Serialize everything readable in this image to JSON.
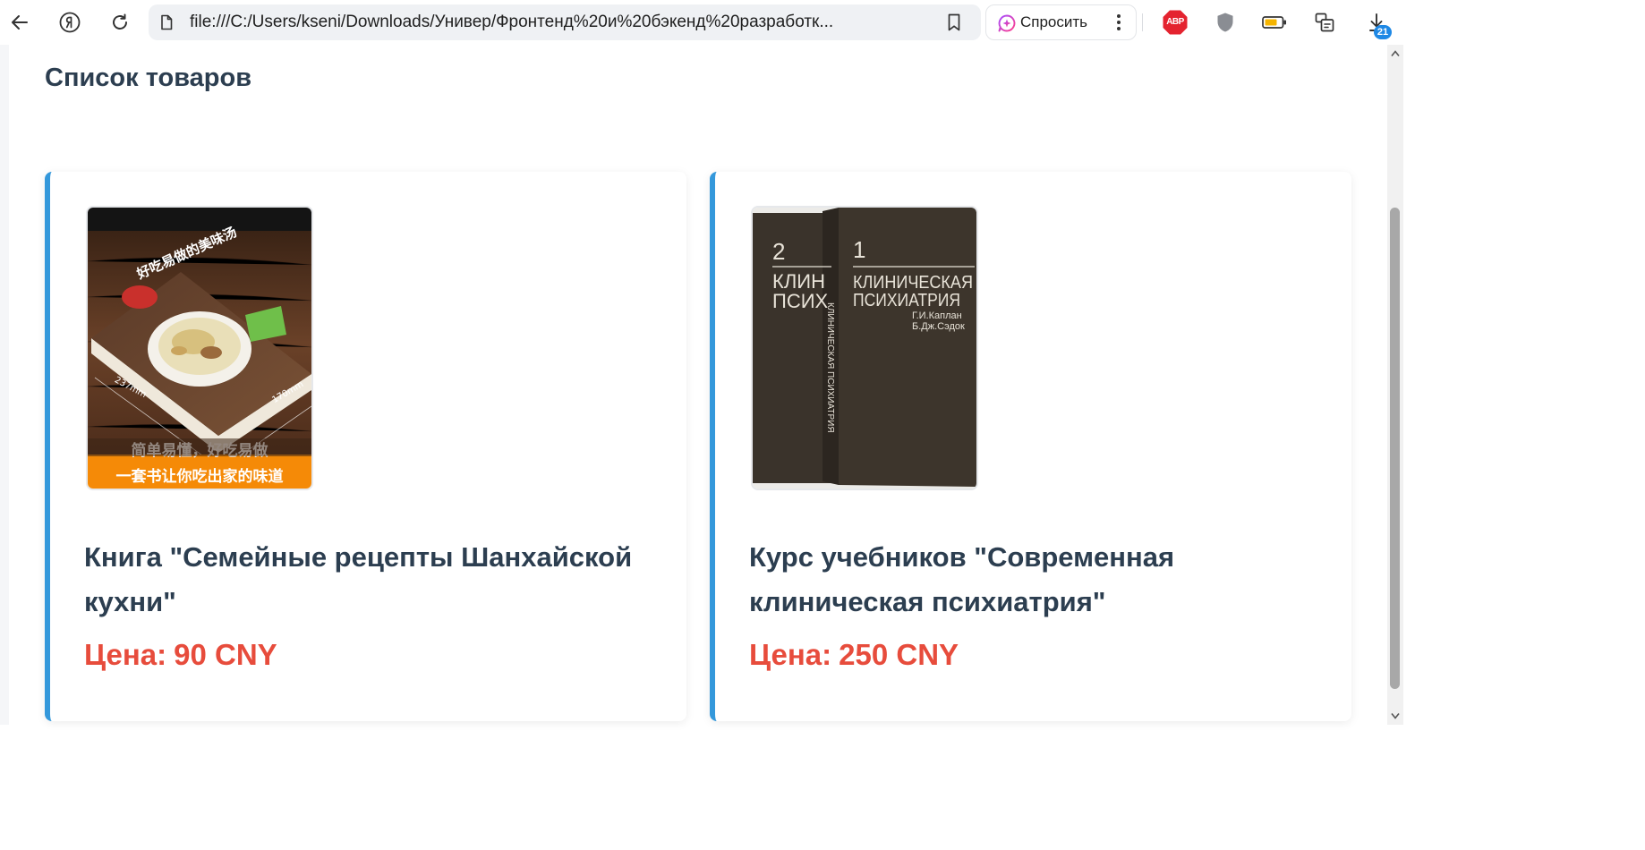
{
  "browser": {
    "url": "file:///C:/Users/kseni/Downloads/Универ/Фронтенд%20и%20бэкенд%20разработк...",
    "ask_label": "Спросить",
    "abp_label": "ABP",
    "downloads_badge": "21",
    "icons": [
      "back-icon",
      "yandex-icon",
      "reload-icon",
      "file-icon",
      "bookmark-icon",
      "ask-icon",
      "menu-dots-icon",
      "adblock-icon",
      "shield-icon",
      "battery-icon",
      "screenshot-icon",
      "downloads-icon"
    ]
  },
  "page": {
    "title": "Список товаров",
    "products": [
      {
        "name": "Книга \"Семейные рецепты Шанхайской кухни\"",
        "price_label": "Цена:",
        "price": "90 CNY",
        "image": {
          "caption_line1": "简单易懂，好吃易做",
          "caption_line2": "一套书让你吃出家的味道",
          "cover_title": "好吃易做的美味汤",
          "dim_length": "237mm",
          "dim_width": "170mm"
        }
      },
      {
        "name": "Курс учебников \"Современная клиническая психиатрия\"",
        "price_label": "Цена:",
        "price": "250 CNY",
        "image": {
          "vol_back": "2",
          "vol_front": "1",
          "back_title_1": "КЛИН",
          "back_title_2": "ПСИХ",
          "front_title_1": "КЛИНИЧЕСКАЯ",
          "front_title_2": "ПСИХИАТРИЯ",
          "author_1": "Г.И.Каплан",
          "author_2": "Б.Дж.Сэдок",
          "spine_text": "КЛИНИЧЕСКАЯ ПСИХИАТРИЯ"
        }
      }
    ]
  },
  "colors": {
    "accent": "#3498db",
    "title": "#2c3e50",
    "price": "#e74c3c"
  }
}
